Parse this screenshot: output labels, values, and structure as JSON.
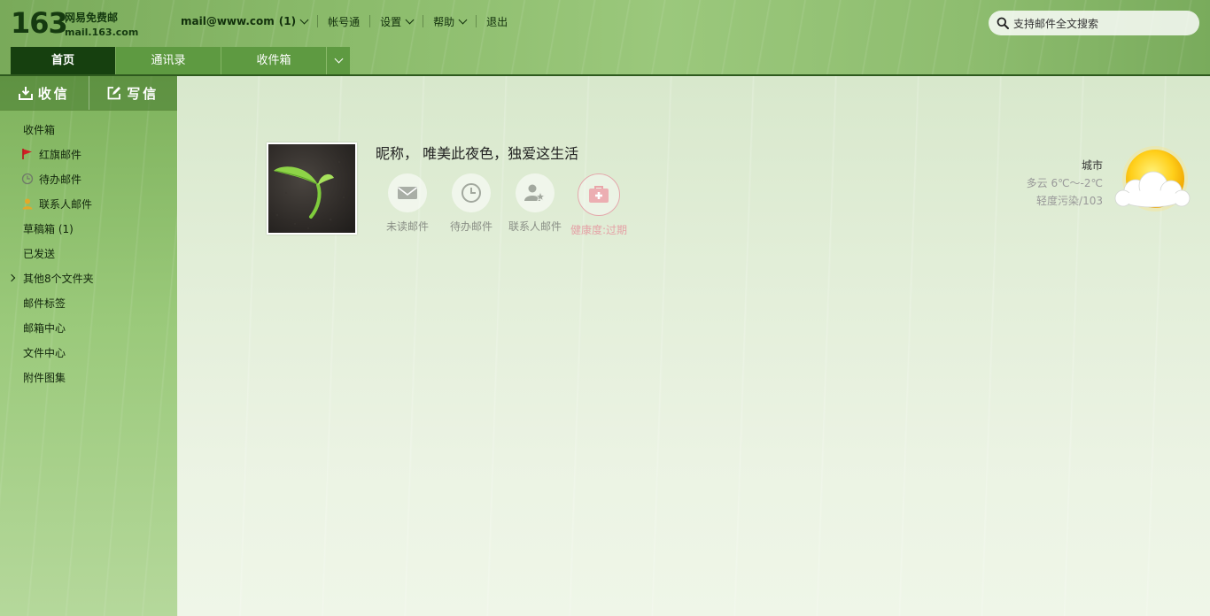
{
  "header": {
    "logo_number": "163",
    "logo_name": "网易免费邮",
    "logo_domain": "mail.163.com",
    "account": "mail@www.com",
    "account_count": "(1)",
    "links": [
      "帐号通",
      "设置",
      "帮助",
      "退出"
    ],
    "search_placeholder": "支持邮件全文搜索"
  },
  "tabs": [
    "首页",
    "通讯录",
    "收件箱"
  ],
  "sidebar": {
    "receive_label": "收信",
    "compose_label": "写信",
    "folders": [
      {
        "label": "收件箱",
        "icon": ""
      },
      {
        "label": "红旗邮件",
        "icon": "red-flag-icon"
      },
      {
        "label": "待办邮件",
        "icon": "clock-icon"
      },
      {
        "label": "联系人邮件",
        "icon": "contact-person-icon"
      },
      {
        "label": "草稿箱 (1)",
        "icon": ""
      },
      {
        "label": "已发送",
        "icon": ""
      },
      {
        "label": "其他8个文件夹",
        "icon": "expand-arrow-icon"
      },
      {
        "label": "邮件标签",
        "icon": ""
      },
      {
        "label": "邮箱中心",
        "icon": ""
      },
      {
        "label": "文件中心",
        "icon": ""
      },
      {
        "label": "附件图集",
        "icon": ""
      }
    ]
  },
  "profile": {
    "nickname": "昵称， 唯美此夜色，独爱这生活",
    "quick_items": [
      "未读邮件",
      "待办邮件",
      "联系人邮件",
      "健康度:过期"
    ]
  },
  "weather": {
    "city": "城市",
    "temperature": "多云 6℃～-2℃",
    "air_quality": "轻度污染/103",
    "icon": "sun-cloud-icon"
  },
  "colors": {
    "active_tab": "#16400f",
    "tab": "#5e9a41",
    "health": "#e4a2a6"
  }
}
